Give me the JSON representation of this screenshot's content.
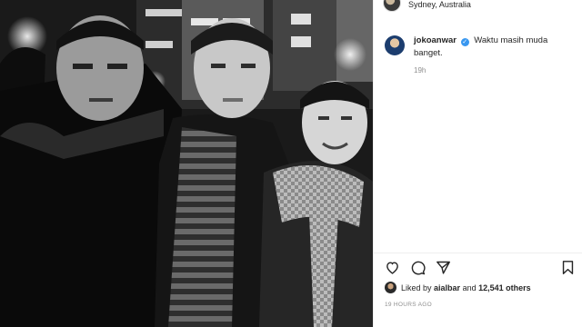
{
  "post": {
    "location": "Sydney, Australia",
    "author": {
      "username": "jokoanwar",
      "verified_icon": "verified-badge-icon"
    },
    "caption": "Waktu masih muda banget.",
    "comment_time": "19h",
    "actions": {
      "like_icon": "heart-icon",
      "comment_icon": "comment-icon",
      "share_icon": "share-icon",
      "save_icon": "bookmark-icon"
    },
    "likes": {
      "prefix": "Liked by",
      "first_liker": "aialbar",
      "connector": "and",
      "others": "12,541 others"
    },
    "timestamp": "19 HOURS AGO"
  },
  "colors": {
    "verified": "#3897f0",
    "muted_text": "#8e8e8e",
    "text": "#262626"
  }
}
